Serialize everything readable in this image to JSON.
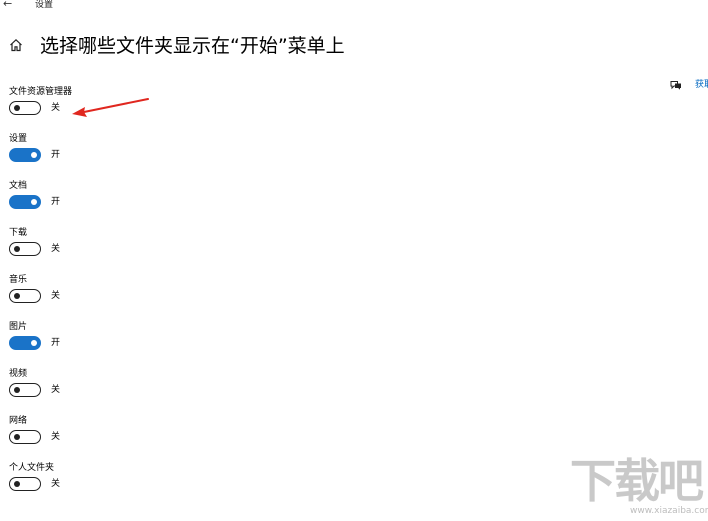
{
  "window": {
    "back_glyph": "←",
    "app_title": "设置"
  },
  "header": {
    "title": "选择哪些文件夹显示在“开始”菜单上",
    "home_icon": "home-icon"
  },
  "feedback": {
    "icon": "feedback-icon",
    "label": "获取"
  },
  "settings": [
    {
      "label": "文件资源管理器",
      "on": false,
      "state_text": "关"
    },
    {
      "label": "设置",
      "on": true,
      "state_text": "开"
    },
    {
      "label": "文档",
      "on": true,
      "state_text": "开"
    },
    {
      "label": "下载",
      "on": false,
      "state_text": "关"
    },
    {
      "label": "音乐",
      "on": false,
      "state_text": "关"
    },
    {
      "label": "图片",
      "on": true,
      "state_text": "开"
    },
    {
      "label": "视频",
      "on": false,
      "state_text": "关"
    },
    {
      "label": "网络",
      "on": false,
      "state_text": "关"
    },
    {
      "label": "个人文件夹",
      "on": false,
      "state_text": "关"
    }
  ],
  "colors": {
    "toggle_on": "#1a73c8",
    "toggle_off_border": "#222222",
    "annotation_arrow": "#e0271f",
    "link": "#0067c0"
  },
  "watermark": {
    "text": "下载吧",
    "url": "www.xiazaiba.com"
  }
}
